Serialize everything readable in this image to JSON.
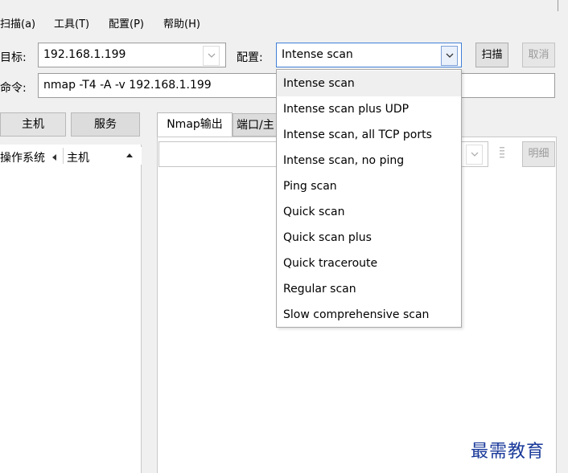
{
  "menu": {
    "items": [
      {
        "label": "扫描(a)"
      },
      {
        "label": "工具(T)"
      },
      {
        "label": "配置(P)"
      },
      {
        "label": "帮助(H)"
      }
    ]
  },
  "toolbar": {
    "target_label": "目标:",
    "target_value": "192.168.1.199",
    "profile_label": "配置:",
    "profile_value": "Intense scan",
    "scan_button": "扫描",
    "cancel_button": "取消"
  },
  "command": {
    "label": "命令:",
    "value": "nmap -T4 -A -v 192.168.1.199"
  },
  "left_tabs": {
    "hosts": "主机",
    "services": "服务"
  },
  "host_list": {
    "os_header": "操作系统",
    "host_header": "主机"
  },
  "right_tabs": {
    "nmap_output": "Nmap输出",
    "ports_hosts": "端口/主"
  },
  "output_panel": {
    "details_button": "明细"
  },
  "profile_dropdown": {
    "selected": "Intense scan",
    "options": [
      "Intense scan",
      "Intense scan plus UDP",
      "Intense scan, all TCP ports",
      "Intense scan, no ping",
      "Ping scan",
      "Quick scan",
      "Quick scan plus",
      "Quick traceroute",
      "Regular scan",
      "Slow comprehensive scan"
    ]
  },
  "watermark": "最需教育",
  "colors": {
    "window_bg": "#f0f0f0",
    "dropdown_highlight": "#efefef",
    "watermark": "#1a3a9a"
  }
}
